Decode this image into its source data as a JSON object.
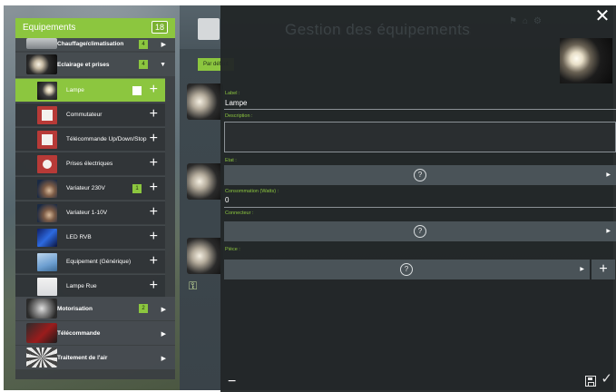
{
  "sidebar": {
    "title": "Equipements",
    "count": "18",
    "partial_category": {
      "label": "Chauffage/climatisation",
      "badge": "4"
    },
    "categories": [
      {
        "label": "Eclairage et prises",
        "badge": "4",
        "thumb": "lamp-thumb"
      },
      {
        "label": "Motorisation",
        "badge": "2",
        "thumb": "gear-thumb"
      },
      {
        "label": "Télécommande",
        "badge": "",
        "thumb": "remote-thumb"
      },
      {
        "label": "Traitement de l'air",
        "badge": "",
        "thumb": "fan-thumb"
      }
    ],
    "items": [
      {
        "label": "Lampe",
        "badge": "",
        "selected": true,
        "thumb": "lamp-thumb"
      },
      {
        "label": "Commutateur",
        "badge": "",
        "selected": false,
        "thumb": "switch-thumb"
      },
      {
        "label": "Télécommande Up/Down/Stop",
        "badge": "",
        "selected": false,
        "thumb": "switch-thumb"
      },
      {
        "label": "Prises électriques",
        "badge": "",
        "selected": false,
        "thumb": "socket-thumb"
      },
      {
        "label": "Variateur 230V",
        "badge": "1",
        "selected": false,
        "thumb": "hand-thumb"
      },
      {
        "label": "Variateur 1-10V",
        "badge": "",
        "selected": false,
        "thumb": "hand-thumb"
      },
      {
        "label": "LED RVB",
        "badge": "",
        "selected": false,
        "thumb": "led-thumb"
      },
      {
        "label": "Equipement (Générique)",
        "badge": "",
        "selected": false,
        "thumb": "generic-thumb"
      },
      {
        "label": "Lampe Rue",
        "badge": "",
        "selected": false,
        "thumb": "street-thumb"
      }
    ]
  },
  "background_page": {
    "title": "Gestion des équipements",
    "default_tab": "Par défaut",
    "key_icon": "key-icon"
  },
  "dialog": {
    "close_symbol": "✕",
    "fields": {
      "label_title": "Label :",
      "label_value": "Lampe",
      "description_title": "Description :",
      "etat_title": "Etat :",
      "consommation_title": "Consommation (Watts) :",
      "consommation_value": "0",
      "connecteur_title": "Connecteur :",
      "piece_title": "Pièce :"
    },
    "select_placeholder_symbol": "?",
    "add_symbol": "+",
    "minus_symbol": "−",
    "confirm_symbol": "✓"
  },
  "colors": {
    "accent_green": "#8cc63f",
    "panel_dark": "#222628",
    "select_bar": "#4a5358"
  }
}
